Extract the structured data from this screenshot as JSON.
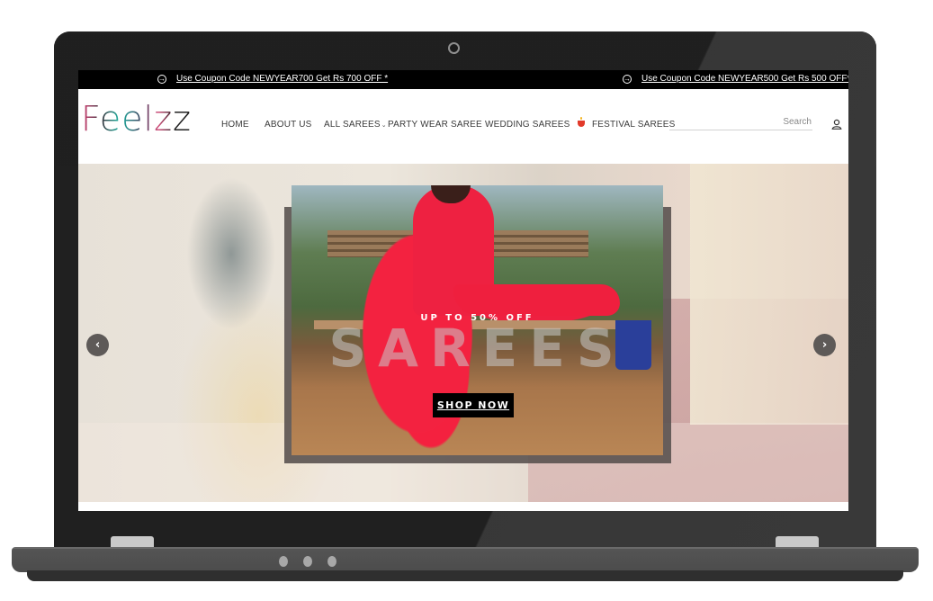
{
  "announcement_bar": {
    "coupons": [
      {
        "icon": "arrow-right-circle-icon",
        "text": "Use Coupon Code NEWYEAR700 Get Rs 700 OFF *"
      },
      {
        "icon": "arrow-right-circle-icon",
        "text": "Use Coupon Code NEWYEAR500 Get Rs 500 OFF*"
      }
    ]
  },
  "header": {
    "logo": "Feelzz",
    "nav": [
      {
        "label": "HOME"
      },
      {
        "label": "ABOUT US"
      },
      {
        "label": "ALL SAREES",
        "has_dropdown": true,
        "dropdown_icon": "⌄"
      },
      {
        "label": "PARTY WEAR SAREE"
      },
      {
        "label": "WEDDING SAREES"
      },
      {
        "label": "FESTIVAL SAREES",
        "icon": "diya-lamp-icon"
      }
    ],
    "search": {
      "placeholder": "Search"
    },
    "account_icon": "user-icon"
  },
  "hero": {
    "promo_text": "UP TO 50% OFF",
    "headline": "SAREES",
    "cta_label": "SHOP NOW",
    "prev_arrow": "‹",
    "next_arrow": "›"
  },
  "colors": {
    "announcement_bg": "#000000",
    "nav_text": "#3a3a3a",
    "cta_bg": "#000000",
    "slider_arrow_bg": "#5e5a58",
    "laptop_body": "#2b2b2b"
  }
}
